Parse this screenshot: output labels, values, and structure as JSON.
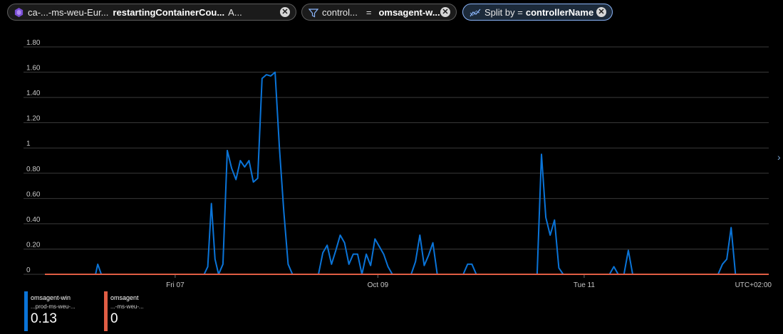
{
  "toolbar": {
    "metric_pill": {
      "scope": "ca-...-ms-weu-Eur...",
      "metric": "restartingContainerCou...",
      "aggregation": "A..."
    },
    "filter_pill": {
      "property": "control...",
      "operator": "=",
      "value": "omsagent-w..."
    },
    "split_pill": {
      "label": "Split by =",
      "value": "controllerName"
    },
    "close_glyph": "✕"
  },
  "chart_data": {
    "type": "line",
    "title": "",
    "xlabel": "",
    "ylabel": "",
    "ylim": [
      0,
      1.8
    ],
    "yticks": [
      "0",
      "0.20",
      "0.40",
      "0.60",
      "0.80",
      "1",
      "1.20",
      "1.40",
      "1.60",
      "1.80"
    ],
    "xticks": [
      {
        "label": "Fri 07",
        "t": 0.18
      },
      {
        "label": "Oct 09",
        "t": 0.46
      },
      {
        "label": "Tue 11",
        "t": 0.745
      }
    ],
    "timezone": "UTC+02:00",
    "series": [
      {
        "name": "omsagent-win",
        "color": "#0a74d8",
        "points": [
          [
            0.0,
            0
          ],
          [
            0.07,
            0
          ],
          [
            0.073,
            0.08
          ],
          [
            0.078,
            0
          ],
          [
            0.22,
            0
          ],
          [
            0.225,
            0.06
          ],
          [
            0.23,
            0.56
          ],
          [
            0.235,
            0.12
          ],
          [
            0.24,
            0
          ],
          [
            0.246,
            0.08
          ],
          [
            0.252,
            0.98
          ],
          [
            0.258,
            0.84
          ],
          [
            0.264,
            0.75
          ],
          [
            0.27,
            0.9
          ],
          [
            0.276,
            0.85
          ],
          [
            0.282,
            0.9
          ],
          [
            0.288,
            0.73
          ],
          [
            0.294,
            0.76
          ],
          [
            0.3,
            1.55
          ],
          [
            0.306,
            1.58
          ],
          [
            0.312,
            1.57
          ],
          [
            0.318,
            1.6
          ],
          [
            0.324,
            1.0
          ],
          [
            0.33,
            0.5
          ],
          [
            0.336,
            0.08
          ],
          [
            0.342,
            0
          ],
          [
            0.378,
            0
          ],
          [
            0.384,
            0.17
          ],
          [
            0.39,
            0.23
          ],
          [
            0.396,
            0.08
          ],
          [
            0.402,
            0.19
          ],
          [
            0.408,
            0.31
          ],
          [
            0.414,
            0.25
          ],
          [
            0.42,
            0.08
          ],
          [
            0.426,
            0.16
          ],
          [
            0.432,
            0.16
          ],
          [
            0.438,
            0
          ],
          [
            0.444,
            0.16
          ],
          [
            0.45,
            0.07
          ],
          [
            0.456,
            0.28
          ],
          [
            0.462,
            0.22
          ],
          [
            0.468,
            0.16
          ],
          [
            0.474,
            0.06
          ],
          [
            0.48,
            0
          ],
          [
            0.506,
            0
          ],
          [
            0.512,
            0.1
          ],
          [
            0.518,
            0.31
          ],
          [
            0.524,
            0.07
          ],
          [
            0.53,
            0.15
          ],
          [
            0.536,
            0.25
          ],
          [
            0.542,
            0
          ],
          [
            0.578,
            0
          ],
          [
            0.584,
            0.08
          ],
          [
            0.59,
            0.08
          ],
          [
            0.596,
            0
          ],
          [
            0.68,
            0
          ],
          [
            0.686,
            0.95
          ],
          [
            0.692,
            0.45
          ],
          [
            0.698,
            0.31
          ],
          [
            0.704,
            0.43
          ],
          [
            0.71,
            0.05
          ],
          [
            0.716,
            0
          ],
          [
            0.78,
            0
          ],
          [
            0.786,
            0.06
          ],
          [
            0.792,
            0
          ],
          [
            0.8,
            0
          ],
          [
            0.806,
            0.19
          ],
          [
            0.812,
            0
          ],
          [
            0.93,
            0
          ],
          [
            0.936,
            0.08
          ],
          [
            0.942,
            0.12
          ],
          [
            0.948,
            0.37
          ],
          [
            0.954,
            0
          ],
          [
            1.0,
            0
          ]
        ]
      },
      {
        "name": "omsagent",
        "color": "#e05d44",
        "points": [
          [
            0.0,
            0
          ],
          [
            1.0,
            0
          ]
        ]
      }
    ]
  },
  "legend": [
    {
      "name": "omsagent-win",
      "resource": "...prod-ms-weu-...",
      "value": "0.13",
      "color": "#0a74d8"
    },
    {
      "name": "omsagent",
      "resource": "...-ms-weu-...",
      "value": "0",
      "color": "#e05d44"
    }
  ],
  "side_chevron": "›"
}
